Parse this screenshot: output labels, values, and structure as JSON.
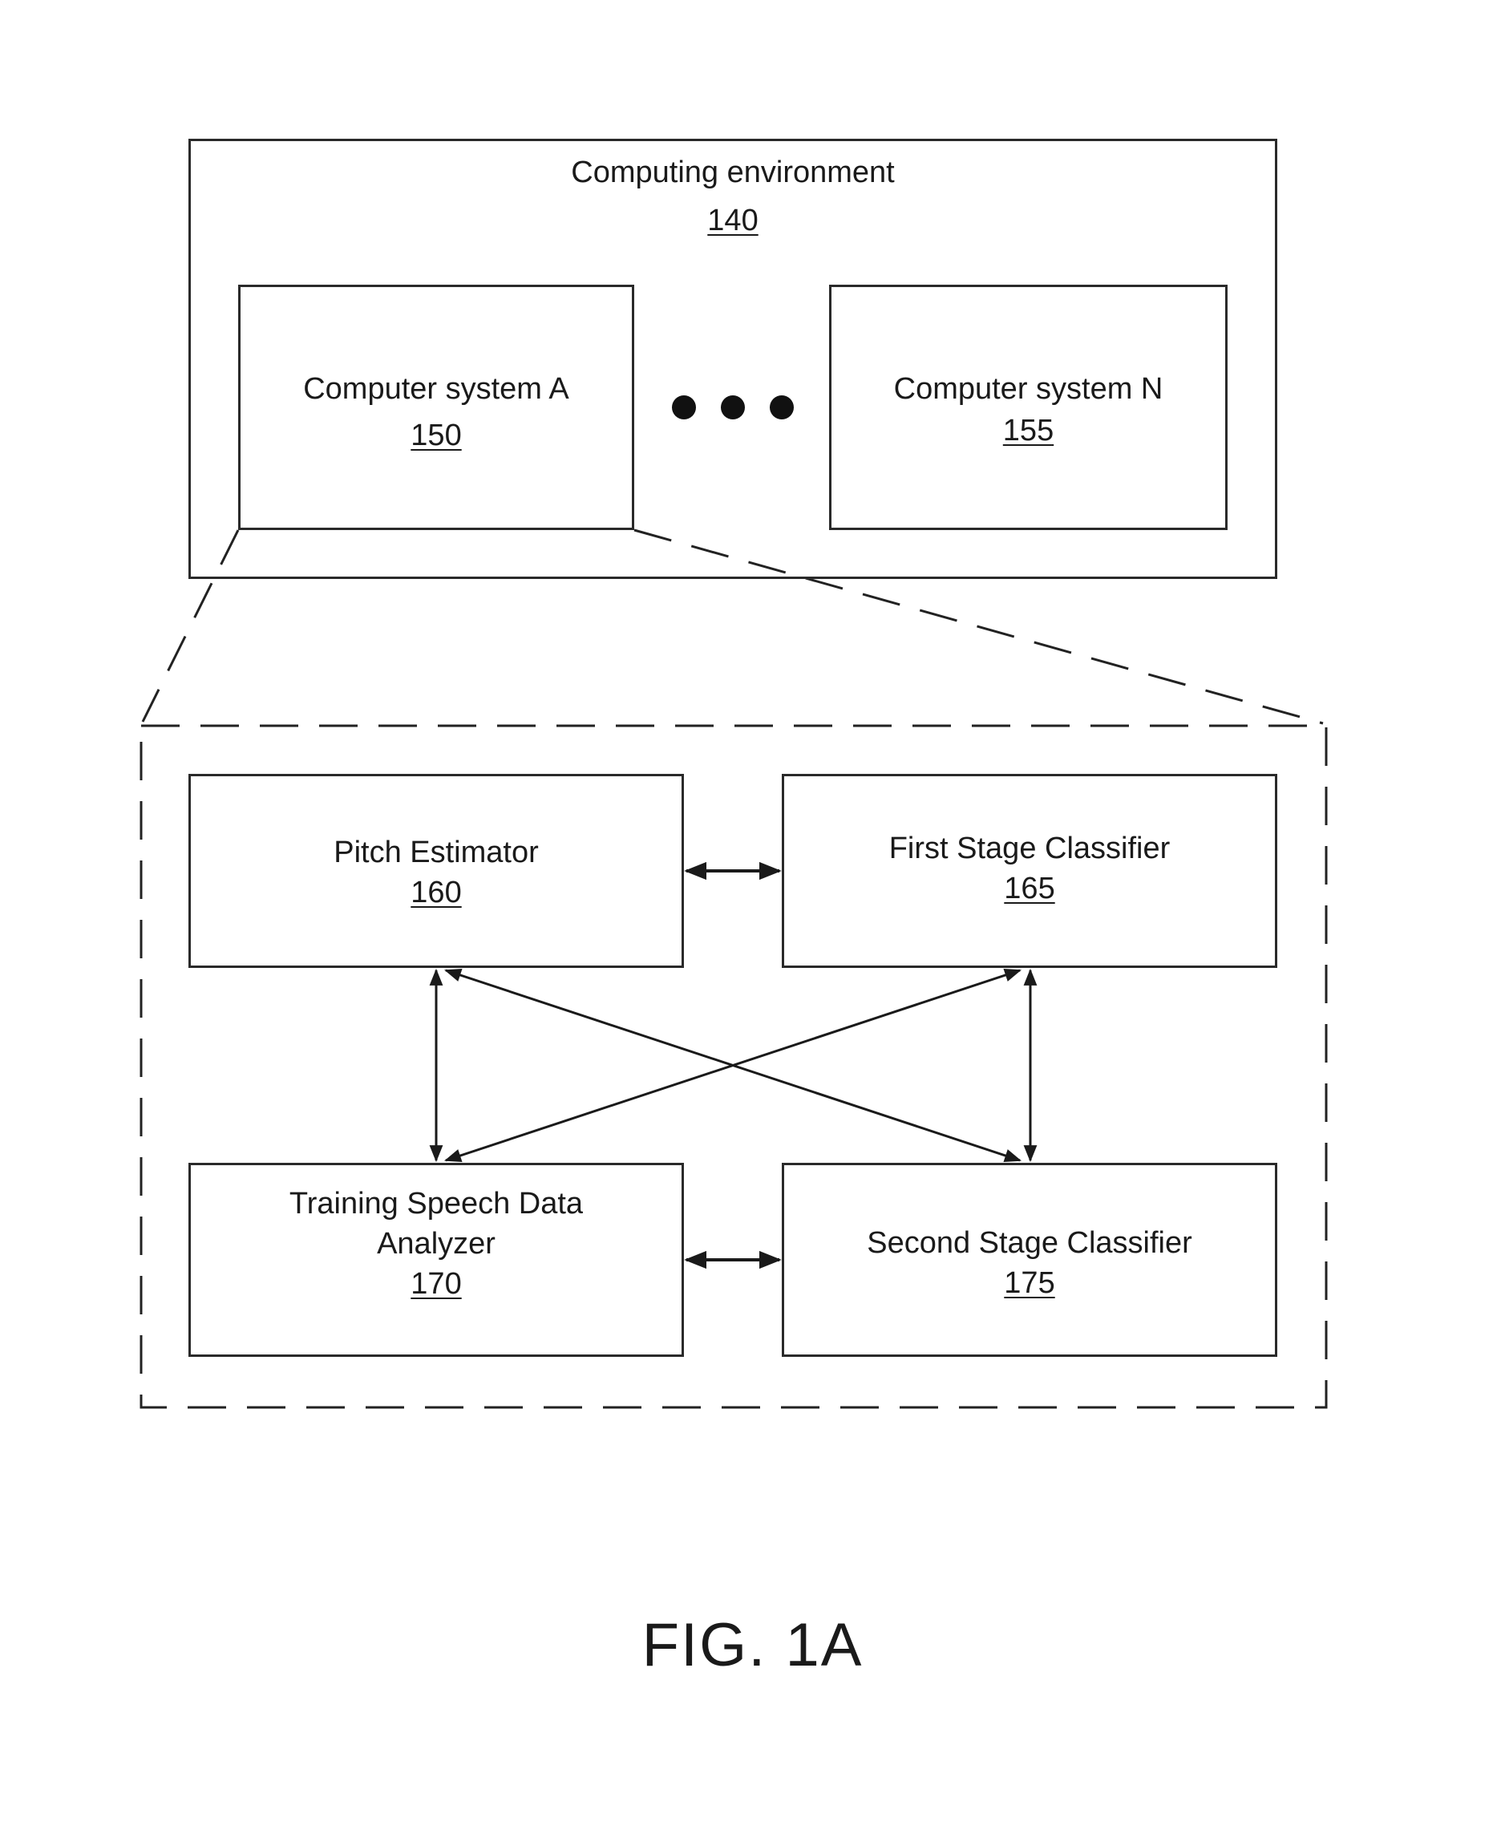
{
  "environment": {
    "title": "Computing environment",
    "ref": "140"
  },
  "systems": [
    {
      "title": "Computer system A",
      "ref": "150"
    },
    {
      "title": "Computer system N",
      "ref": "155"
    }
  ],
  "ellipsis": "•••",
  "modules": {
    "pitch": {
      "title": "Pitch Estimator",
      "ref": "160"
    },
    "first": {
      "title": "First Stage Classifier",
      "ref": "165"
    },
    "training": {
      "title_line1": "Training Speech Data",
      "title_line2": "Analyzer",
      "ref": "170"
    },
    "second": {
      "title": "Second Stage Classifier",
      "ref": "175"
    }
  },
  "connections": [
    {
      "from": "160",
      "to": "165",
      "type": "bidirectional"
    },
    {
      "from": "160",
      "to": "170",
      "type": "bidirectional"
    },
    {
      "from": "160",
      "to": "175",
      "type": "bidirectional"
    },
    {
      "from": "165",
      "to": "170",
      "type": "bidirectional"
    },
    {
      "from": "165",
      "to": "175",
      "type": "bidirectional"
    },
    {
      "from": "170",
      "to": "175",
      "type": "bidirectional"
    }
  ],
  "figure_label": "FIG. 1A"
}
